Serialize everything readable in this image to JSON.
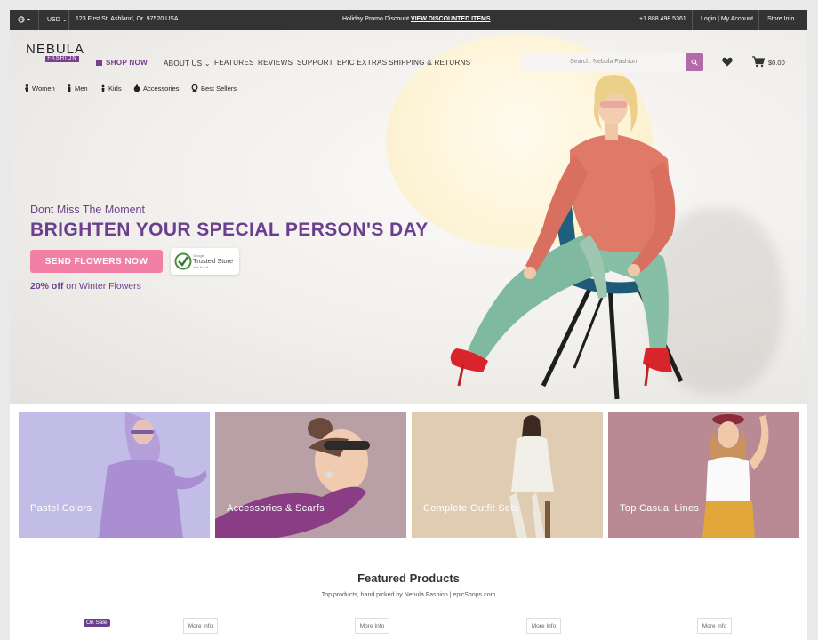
{
  "topbar": {
    "currency": "USD",
    "address": "123 First St. Ashland, Or. 97520 USA",
    "promo_text": "Holiday Promo Discount",
    "promo_link": "VIEW DISCOUNTED ITEMS",
    "phone": "+1 888 498 5361",
    "account": "Login | My Account",
    "store_info": "Store Info"
  },
  "logo": {
    "name": "NEBULA",
    "sub": "FASHION"
  },
  "nav": {
    "shop_now": "SHOP NOW",
    "items": [
      "ABOUT US",
      "FEATURES",
      "REVIEWS",
      "SUPPORT",
      "EPIC EXTRAS",
      "SHIPPING & RETURNS"
    ],
    "search_placeholder": "Search: Nebula Fashion",
    "cart_total": "$0.00",
    "icons": {
      "shop": "square-icon",
      "search": "search-icon",
      "wishlist": "heart-icon",
      "cart": "cart-icon"
    }
  },
  "categories": [
    {
      "label": "Women",
      "icon": "woman-icon"
    },
    {
      "label": "Men",
      "icon": "man-icon"
    },
    {
      "label": "Kids",
      "icon": "child-icon"
    },
    {
      "label": "Accessories",
      "icon": "bag-icon"
    },
    {
      "label": "Best Sellers",
      "icon": "award-icon"
    }
  ],
  "hero": {
    "eyebrow": "Dont Miss The Moment",
    "headline": "BRIGHTEN YOUR SPECIAL PERSON'S DAY",
    "cta": "SEND FLOWERS NOW",
    "badge_small": "Google",
    "badge_text": "Trusted Store",
    "badge_stars": "★★★★★",
    "offer_bold": "20% off",
    "offer_rest": "on Winter Flowers"
  },
  "tiles": [
    {
      "label": "Pastel Colors",
      "bg": "#c2bde6"
    },
    {
      "label": "Accessories & Scarfs",
      "bg": "#b8a0a6"
    },
    {
      "label": "Complete Outfit Sets",
      "bg": "#e0ccb3"
    },
    {
      "label": "Top Casual Lines",
      "bg": "#b98a93"
    }
  ],
  "featured": {
    "title": "Featured Products",
    "subtitle": "Top products, hand picked by Nebula Fashion | epicShops.com",
    "sale_badge": "On Sale",
    "more_info": [
      "More Info",
      "More Info",
      "More Info",
      "More Info"
    ]
  },
  "colors": {
    "brand_purple": "#6b3f8e",
    "cta_pink": "#f280a6",
    "topbar": "#333333"
  }
}
